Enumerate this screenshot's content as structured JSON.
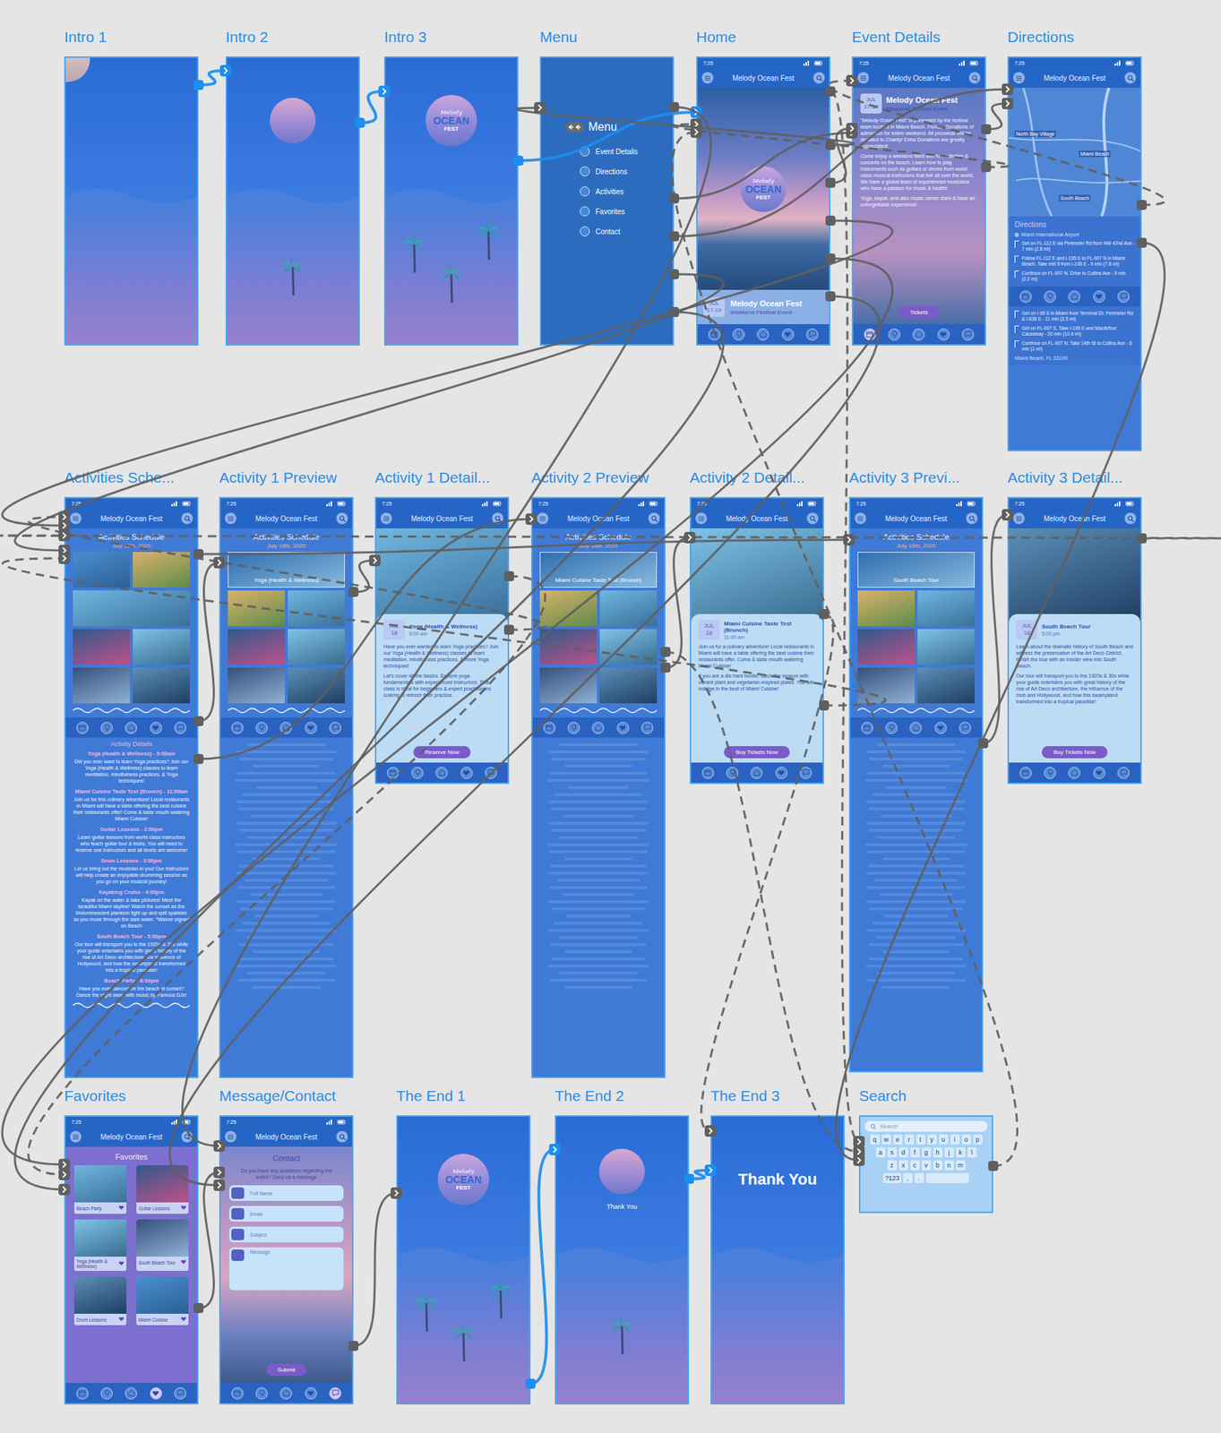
{
  "app": {
    "time": "7:25",
    "title": "Melody Ocean Fest"
  },
  "logo": {
    "top": "Melody",
    "main": "OCEAN",
    "sub": "FEST"
  },
  "boards": [
    {
      "title": "Intro 1",
      "kind": "intro",
      "moon": "corner",
      "logo": false,
      "palms": 0
    },
    {
      "title": "Intro 2",
      "kind": "intro",
      "moon": "center",
      "logo": false,
      "palms": 1
    },
    {
      "title": "Intro 3",
      "kind": "intro",
      "moon": "none",
      "logo": true,
      "palms": 3
    },
    {
      "title": "Menu",
      "kind": "menu",
      "heading": "Menu",
      "items": [
        "Event Details",
        "Directions",
        "Activities",
        "Favorites",
        "Contact"
      ]
    },
    {
      "title": "Home",
      "kind": "home",
      "card": {
        "title": "Melody Ocean Fest",
        "month": "JUL",
        "days": "17-19",
        "subtitle": "Weekend Festival Event"
      },
      "tabbar": [
        {
          "selected": false
        },
        {
          "selected": false
        },
        {
          "selected": false
        },
        {
          "selected": false
        },
        {
          "selected": false
        }
      ]
    },
    {
      "title": "Event Details",
      "kind": "event",
      "heading": "Melody Ocean Fest",
      "subtitle": "Weekend Festival Event",
      "month": "JUL",
      "days": "17-19",
      "paragraphs": [
        "\"Melody Ocean Fest\" is presented by the festival team located in Miami Beach, Florida. Donations of admission for entire weekend. All proceeds will be donated to Charity! Extra Donations are greatly appreciated!",
        "Come enjoy a weekend filled with fun activities & concerts on the beach. Learn how to play instruments such as guitars or drums from world class musical instructors that live all over the world. We have a global team of experienced musicians who have a passion for music & health!",
        "Yoga, kayak, and also music center stars & have an unforgettable experience!"
      ],
      "button": "Tickets",
      "tabbar": [
        {
          "selected": true
        },
        {
          "selected": false
        },
        {
          "selected": false
        },
        {
          "selected": false
        },
        {
          "selected": false
        }
      ]
    },
    {
      "title": "Directions",
      "kind": "directions",
      "mapLabels": [
        "North Bay Village",
        "Miami Beach",
        "South Beach"
      ],
      "heading": "Directions",
      "origin": "Miami International Airport",
      "steps": [
        "Get on FL-112 E via Perimeter Rd from NW 42nd Ave - 7 min (2.8 mi)",
        "Follow FL-112 E and I-195 E to FL-907 N in Miami Beach. Take exit 5 from I-195 E - 9 min (7.8 mi)",
        "Continue on FL-907 N. Drive to Collins Ave - 9 min (2.2 mi)",
        "Get on I-95 S in Miami from Terminal Dr, Perimeter Rd & I-836 E - 11 min (3.5 mi)",
        "Get on FL-907 S, Take I-195 E and MacArthur Causeway - 20 min (10.6 mi)",
        "Continue on FL-907 N. Take 14th St to Collins Ave - 8 min (1 mi)"
      ],
      "destination": "Miami Beach, FL 33109",
      "tabbar": [
        {
          "selected": false
        },
        {
          "selected": false
        },
        {
          "selected": false
        },
        {
          "selected": false
        },
        {
          "selected": false
        }
      ]
    },
    {
      "title": "Activities Sche...",
      "kind": "schedule",
      "heading": "Activities Schedule",
      "date": "July 18th, 2020",
      "section": "Activity Details",
      "activities": [
        {
          "name": "Yoga (Health & Wellness) - 9:00am",
          "text": "Did you ever want to learn Yoga practices? Join our Yoga (Health & Wellness) classes to learn meditation, mindfulness practices, & Yoga techniques!"
        },
        {
          "name": "Miami Cuisine Taste Test (Brunch) - 11:00am",
          "text": "Join us for this culinary adventure! Local restaurants in Miami will have a table offering the best cuisine their restaurants offer! Come & taste mouth watering Miami Cuisine!"
        },
        {
          "name": "Guitar Lessons - 2:00pm",
          "text": "Learn guitar lessons from world class instructors who teach guitar tour & tricks. You will need to reserve one instructors and all levels are welcome!"
        },
        {
          "name": "Drum Lessons - 3:00pm",
          "text": "Let us bring out the musician in you! Our instructors will help create an enjoyable drumming session as you go on your musical journey!"
        },
        {
          "name": "Kayaking Cruise - 4:00pm",
          "text": "Kayak on the water & take pictures! Meet the beautiful Miami skyline! Watch the sunset as the bioluminescent plankton light up and spill sparkles as you move through the dark water. *Waiver signed on Beach"
        },
        {
          "name": "South Beach Tour - 5:00pm",
          "text": "Our tour will transport you to the 1920s & 30s while your guide entertains you with great history of the rise of Art Deco architecture, the influence of Hollywood, and how the swampland transformed into a tropical paradise!"
        },
        {
          "name": "Beach Party - 8:00pm",
          "text": "Have you ever danced on the beach at sunset? Dance the night away with music by Famous DJs!"
        }
      ],
      "tabbar": [
        {
          "selected": false
        },
        {
          "selected": false
        },
        {
          "selected": false
        },
        {
          "selected": false
        },
        {
          "selected": false
        }
      ]
    },
    {
      "title": "Activity 1 Preview",
      "kind": "preview",
      "heading": "Activities Schedule",
      "date": "July 18th, 2020",
      "highlight": "Yoga (Health & Wellness)",
      "tabbar": [
        {
          "selected": false
        },
        {
          "selected": false
        },
        {
          "selected": false
        },
        {
          "selected": false
        },
        {
          "selected": false
        }
      ]
    },
    {
      "title": "Activity 1 Detail...",
      "kind": "detail",
      "month": "JUL",
      "day": "18",
      "name": "Yoga (Health & Wellness)",
      "time": "9:00 am",
      "paragraphs": [
        "Have you ever wanted to learn Yoga practices? Join our Yoga (Health & Wellness) classes to learn meditation, mindfulness practices, & more Yoga techniques!",
        "Let's cover all the basics. Explore yoga fundamentals with experienced instructors. This class is ideal for beginners & expert practitioners looking to refresh their practice."
      ],
      "button": "Reserve Now",
      "tabbar": [
        {
          "selected": false
        },
        {
          "selected": false
        },
        {
          "selected": false
        },
        {
          "selected": false
        },
        {
          "selected": false
        }
      ]
    },
    {
      "title": "Activity 2 Preview",
      "kind": "preview",
      "heading": "Activities Schedule",
      "date": "July 18th, 2020",
      "highlight": "Miami Cuisine Taste Test (Brunch)",
      "tabbar": [
        {
          "selected": false
        },
        {
          "selected": false
        },
        {
          "selected": false
        },
        {
          "selected": false
        },
        {
          "selected": false
        }
      ]
    },
    {
      "title": "Activity 2 Detail...",
      "kind": "detail",
      "month": "JUL",
      "day": "18",
      "name": "Miami Cuisine Taste Test (Brunch)",
      "time": "11:00 am",
      "paragraphs": [
        "Join us for a culinary adventure! Local restaurants in Miami will have a table offering the best cuisine their restaurants offer. Come & taste mouth watering Miami Cuisine!",
        "If you are a die hard foodie, catch the season with vibrant plant and vegetarian-inspired plates. You will indulge in the best of Miami Cuisine!"
      ],
      "button": "Buy Tickets Now",
      "tabbar": [
        {
          "selected": false
        },
        {
          "selected": false
        },
        {
          "selected": false
        },
        {
          "selected": false
        },
        {
          "selected": false
        }
      ]
    },
    {
      "title": "Activity 3 Previ...",
      "kind": "preview",
      "heading": "Activities Schedule",
      "date": "July 18th, 2020",
      "highlight": "South Beach Tour",
      "tabbar": [
        {
          "selected": false
        },
        {
          "selected": false
        },
        {
          "selected": false
        },
        {
          "selected": false
        },
        {
          "selected": false
        }
      ]
    },
    {
      "title": "Activity 3 Detail...",
      "kind": "detail",
      "month": "JUL",
      "day": "18",
      "name": "South Beach Tour",
      "time": "5:00 pm",
      "paragraphs": [
        "Learn about the dramatic history of South Beach and witness the preservation of the Art Deco District. Finish the tour with an insider view into South Beach.",
        "Our tour will transport you to the 1920s & 30s while your guide entertains you with great history of the rise of Art Deco architecture, the influence of the mob and Hollywood, and how this swampland transformed into a tropical paradise!"
      ],
      "button": "Buy Tickets Now",
      "tabbar": [
        {
          "selected": false
        },
        {
          "selected": false
        },
        {
          "selected": false
        },
        {
          "selected": false
        },
        {
          "selected": false
        }
      ]
    },
    {
      "title": "Favorites",
      "kind": "favorites",
      "heading": "Favorites",
      "items": [
        {
          "name": "Beach Party",
          "liked": true
        },
        {
          "name": "Guitar Lessons",
          "liked": true
        },
        {
          "name": "Yoga (Health & Wellness)",
          "liked": true
        },
        {
          "name": "South Beach Tour",
          "liked": true
        },
        {
          "name": "Drum Lessons",
          "liked": true
        },
        {
          "name": "Miami Cuisine",
          "liked": true
        }
      ],
      "tabbar": [
        {
          "selected": false
        },
        {
          "selected": false
        },
        {
          "selected": false
        },
        {
          "selected": true
        },
        {
          "selected": false
        }
      ]
    },
    {
      "title": "Message/Contact",
      "kind": "contact",
      "heading": "Contact",
      "intro": "Do you have any questions regarding the event? Send us a message",
      "fields": [
        {
          "label": "Full Name",
          "kind": "line"
        },
        {
          "label": "Email",
          "kind": "line"
        },
        {
          "label": "Subject",
          "kind": "line"
        },
        {
          "label": "Message",
          "kind": "area"
        }
      ],
      "button": "Submit",
      "tabbar": [
        {
          "selected": false
        },
        {
          "selected": false
        },
        {
          "selected": false
        },
        {
          "selected": false
        },
        {
          "selected": true
        }
      ]
    },
    {
      "title": "The End 1",
      "kind": "intro",
      "moon": "none",
      "logo": true,
      "palms": 3
    },
    {
      "title": "The End 2",
      "kind": "intro",
      "moon": "center",
      "logo": false,
      "palms": 1,
      "message": {
        "text": "Thank You",
        "large": false
      }
    },
    {
      "title": "The End 3",
      "kind": "intro",
      "moon": "none",
      "logo": false,
      "palms": 0,
      "message": {
        "text": "Thank You",
        "large": true
      }
    },
    {
      "title": "Search",
      "kind": "search",
      "placeholder": "Search",
      "rows": [
        [
          "q",
          "w",
          "e",
          "r",
          "t",
          "y",
          "u",
          "i",
          "o",
          "p"
        ],
        [
          "a",
          "s",
          "d",
          "f",
          "g",
          "h",
          "j",
          "k",
          "l"
        ],
        [
          "z",
          "x",
          "c",
          "v",
          "b",
          "n",
          "m"
        ]
      ],
      "bottom": [
        "?123",
        ",",
        "."
      ]
    }
  ],
  "links": [
    {
      "from": "Intro 1",
      "to": "Intro 2",
      "kind": "auto"
    },
    {
      "from": "Intro 2",
      "to": "Intro 3",
      "kind": "auto"
    },
    {
      "from": "Intro 3",
      "to": "Home",
      "kind": "auto"
    },
    {
      "from": "Menu",
      "to": "Event Details",
      "kind": "tap"
    },
    {
      "from": "Menu",
      "to": "Directions",
      "kind": "tap"
    },
    {
      "from": "Menu",
      "to": "Activities Sche...",
      "kind": "tap"
    },
    {
      "from": "Menu",
      "to": "Favorites",
      "kind": "tap"
    },
    {
      "from": "Menu",
      "to": "Message/Contact",
      "kind": "tap"
    },
    {
      "from": "Home",
      "to": "Menu",
      "kind": "tap"
    },
    {
      "from": "Home",
      "to": "Event Details",
      "kind": "tap"
    },
    {
      "from": "Home",
      "to": "Activities Sche...",
      "kind": "tap"
    },
    {
      "from": "Home",
      "to": "Favorites",
      "kind": "tap"
    },
    {
      "from": "Home",
      "to": "Message/Contact",
      "kind": "tap"
    },
    {
      "from": "Home",
      "to": "Search",
      "kind": "back"
    },
    {
      "from": "Event Details",
      "to": "Directions",
      "kind": "tap"
    },
    {
      "from": "Event Details",
      "to": "Home",
      "kind": "back"
    },
    {
      "from": "Directions",
      "to": "Event Details",
      "kind": "back"
    },
    {
      "from": "Directions",
      "to": "Search",
      "kind": "tap"
    },
    {
      "from": "Activities Sche...",
      "to": "Activity 1 Preview",
      "kind": "tap"
    },
    {
      "from": "Activities Sche...",
      "to": "Activity 2 Preview",
      "kind": "tap"
    },
    {
      "from": "Activities Sche...",
      "to": "Activity 3 Previ...",
      "kind": "tap"
    },
    {
      "from": "Activity 1 Preview",
      "to": "Activity 1 Detail...",
      "kind": "tap"
    },
    {
      "from": "Activity 1 Detail...",
      "to": "Activities Sche...",
      "kind": "back"
    },
    {
      "from": "Activity 2 Preview",
      "to": "Activity 2 Detail...",
      "kind": "tap"
    },
    {
      "from": "Activity 2 Detail...",
      "to": "Activities Sche...",
      "kind": "back"
    },
    {
      "from": "Activity 3 Previ...",
      "to": "Activity 3 Detail...",
      "kind": "tap"
    },
    {
      "from": "Activity 3 Detail...",
      "to": "Activities Sche...",
      "kind": "back"
    },
    {
      "from": "Activity 1 Detail...",
      "to": "Favorites",
      "kind": "back"
    },
    {
      "from": "Activity 2 Detail...",
      "to": "The End 3",
      "kind": "back"
    },
    {
      "from": "Activity 2 Preview",
      "to": "Search",
      "kind": "back"
    },
    {
      "from": "Favorites",
      "to": "Message/Contact",
      "kind": "tap"
    },
    {
      "from": "Message/Contact",
      "to": "The End 1",
      "kind": "tap"
    },
    {
      "from": "The End 1",
      "to": "The End 2",
      "kind": "auto"
    },
    {
      "from": "The End 2",
      "to": "The End 3",
      "kind": "auto"
    },
    {
      "from": "Search",
      "to": "Home",
      "kind": "back"
    }
  ]
}
